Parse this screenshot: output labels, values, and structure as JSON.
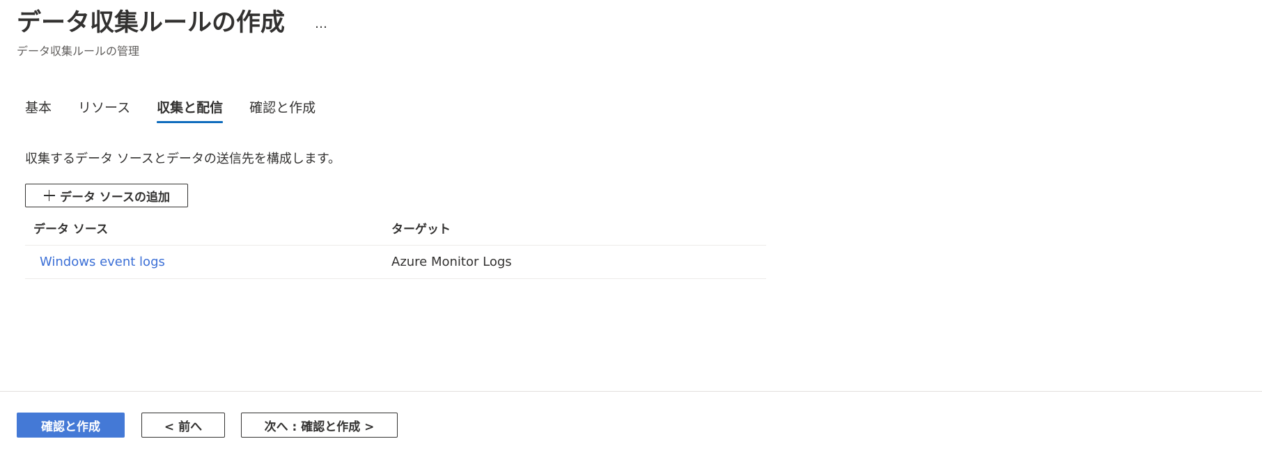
{
  "header": {
    "title": "データ収集ルールの作成",
    "more_label": "…",
    "subtitle": "データ収集ルールの管理"
  },
  "tabs": [
    {
      "label": "基本",
      "active": false
    },
    {
      "label": "リソース",
      "active": false
    },
    {
      "label": "収集と配信",
      "active": true
    },
    {
      "label": "確認と作成",
      "active": false
    }
  ],
  "description": "収集するデータ ソースとデータの送信先を構成します。",
  "add_button": {
    "icon": "plus-icon",
    "label": "データ ソースの追加"
  },
  "table": {
    "columns": [
      "データ ソース",
      "ターゲット"
    ],
    "rows": [
      {
        "source": "Windows event logs",
        "target": "Azure Monitor Logs"
      }
    ]
  },
  "footer": {
    "primary_label": "確認と作成",
    "prev_label": "< 前へ",
    "next_label": "次へ : 確認と作成 >"
  },
  "colors": {
    "accent": "#0f6cbd",
    "primary_button": "#4479d6",
    "link": "#3b6fd6",
    "text": "#323130"
  }
}
